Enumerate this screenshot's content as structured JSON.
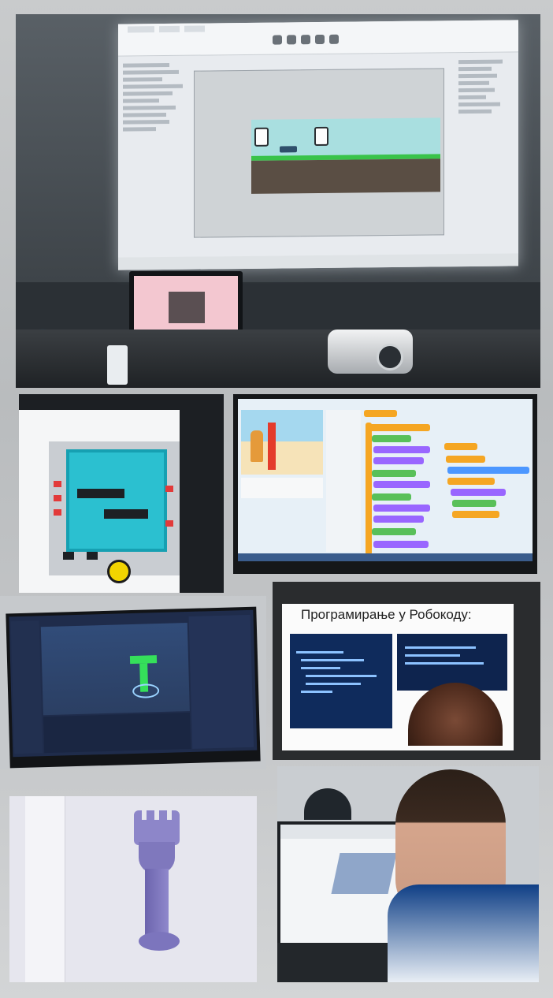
{
  "collage": {
    "tiles": [
      {
        "id": "projector-room"
      },
      {
        "id": "arduino-simulator"
      },
      {
        "id": "scratch-programming"
      },
      {
        "id": "unity-3d-drone"
      },
      {
        "id": "robocode-slide"
      },
      {
        "id": "3d-model-rook"
      },
      {
        "id": "student-cad-laptop"
      }
    ]
  },
  "robocode_slide": {
    "title": "Програмирање у Робокоду:"
  },
  "colors": {
    "background": "#c6c8ca",
    "projection_sky": "#a9dfe0",
    "projection_grass": "#39c34a",
    "arduino_board": "#2bc0d0",
    "scratch_orange": "#f5a623",
    "scratch_green": "#59c059",
    "unity_drone": "#35e05a",
    "rook_purple": "#8d86c9"
  }
}
